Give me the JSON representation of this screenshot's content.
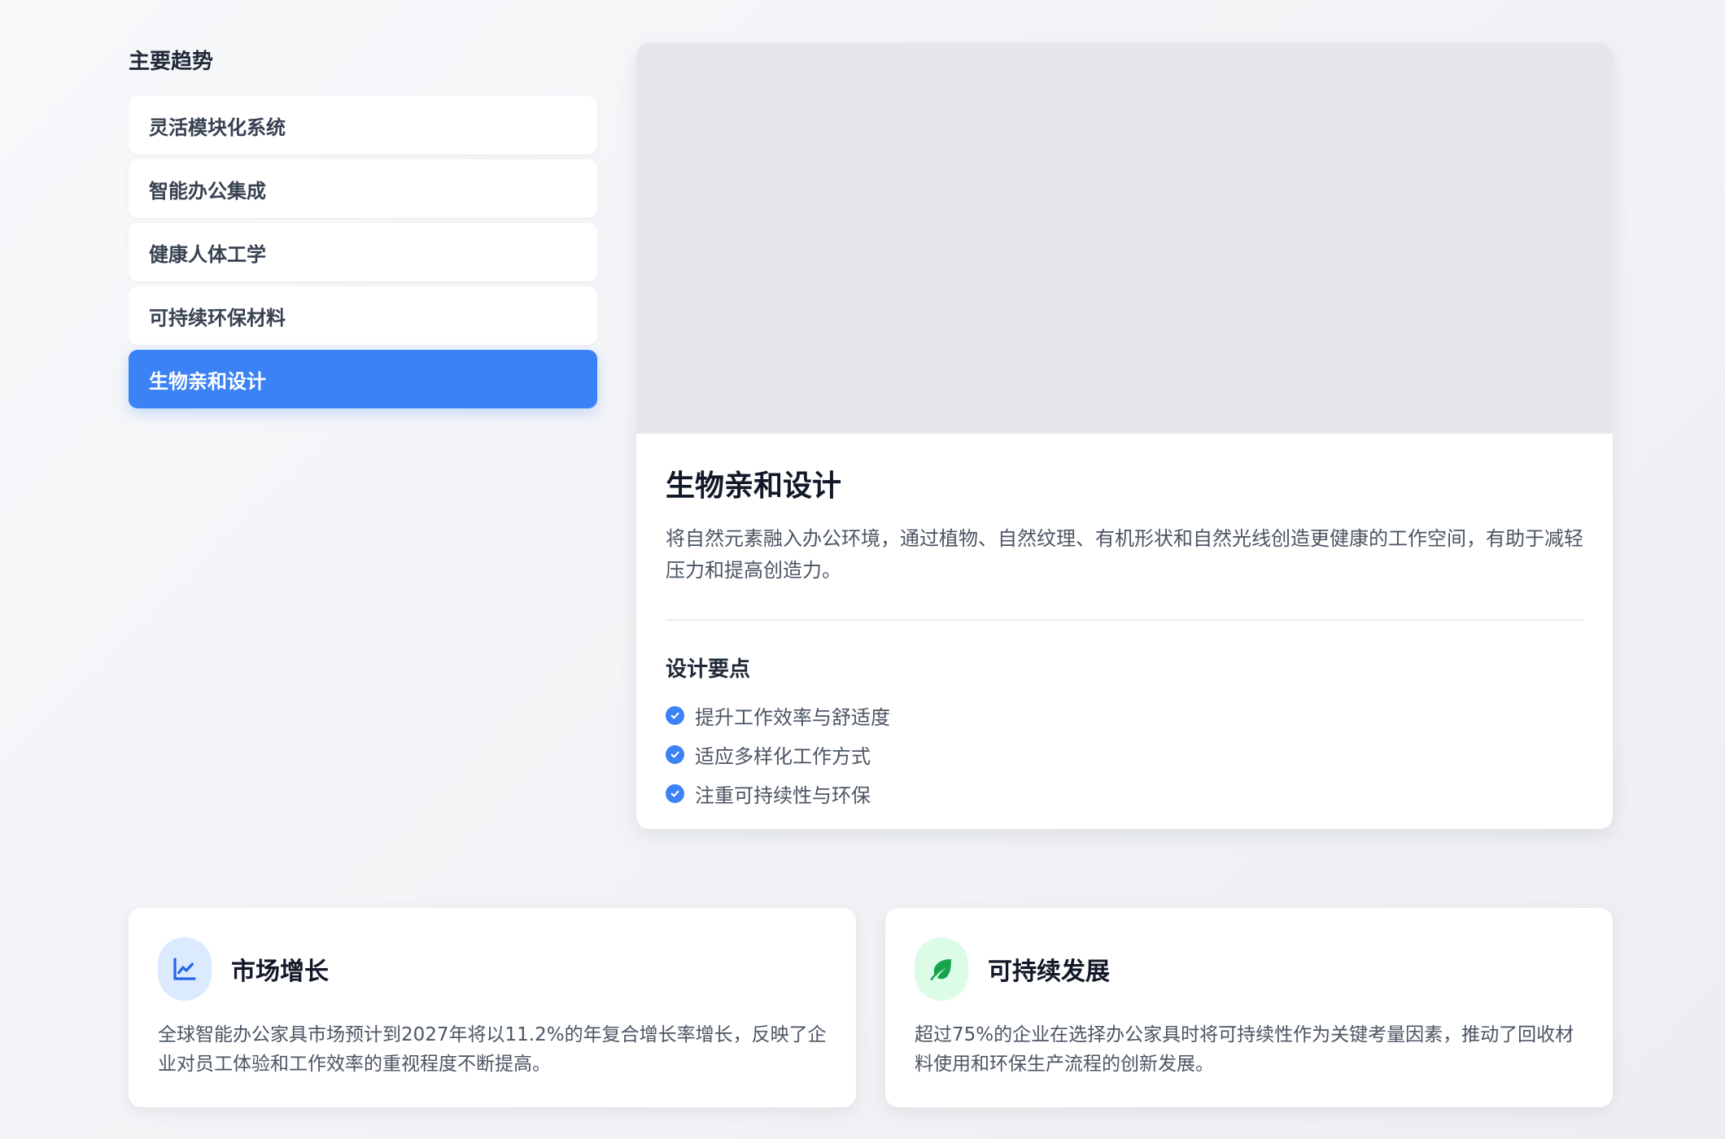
{
  "sidebar": {
    "title": "主要趋势",
    "items": [
      {
        "label": "灵活模块化系统",
        "active": false
      },
      {
        "label": "智能办公集成",
        "active": false
      },
      {
        "label": "健康人体工学",
        "active": false
      },
      {
        "label": "可持续环保材料",
        "active": false
      },
      {
        "label": "生物亲和设计",
        "active": true
      }
    ]
  },
  "detail": {
    "title": "生物亲和设计",
    "description": "将自然元素融入办公环境，通过植物、自然纹理、有机形状和自然光线创造更健康的工作空间，有助于减轻压力和提高创造力。",
    "points_title": "设计要点",
    "points": [
      "提升工作效率与舒适度",
      "适应多样化工作方式",
      "注重可持续性与环保"
    ]
  },
  "stats": {
    "market": {
      "icon": "chart-line-icon",
      "title": "市场增长",
      "description": "全球智能办公家具市场预计到2027年将以11.2%的年复合增长率增长，反映了企业对员工体验和工作效率的重视程度不断提高。"
    },
    "sustain": {
      "icon": "leaf-icon",
      "title": "可持续发展",
      "description": "超过75%的企业在选择办公家具时将可持续性作为关键考量因素，推动了回收材料使用和环保生产流程的创新发展。"
    }
  },
  "colors": {
    "accent": "#3b82f6",
    "icon_blue": "#2563eb",
    "icon_green": "#16a34a"
  }
}
